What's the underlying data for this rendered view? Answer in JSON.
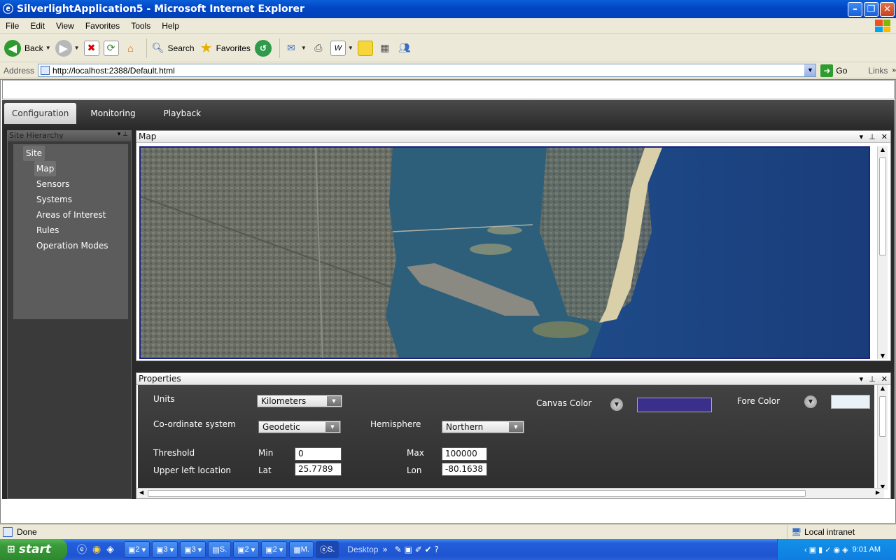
{
  "window": {
    "title": "SilverlightApplication5 - Microsoft Internet Explorer"
  },
  "menu": [
    "File",
    "Edit",
    "View",
    "Favorites",
    "Tools",
    "Help"
  ],
  "toolbar": {
    "back": "Back",
    "search": "Search",
    "favorites": "Favorites"
  },
  "address": {
    "label": "Address",
    "url": "http://localhost:2388/Default.html",
    "go": "Go",
    "links": "Links"
  },
  "app": {
    "tabs": [
      "Configuration",
      "Monitoring",
      "Playback"
    ],
    "left_panel": {
      "title": "Site Hierarchy",
      "root": "Site",
      "children": [
        "Map",
        "Sensors",
        "Systems",
        "Areas of Interest",
        "Rules",
        "Operation Modes"
      ]
    },
    "map_panel": {
      "title": "Map"
    },
    "properties": {
      "title": "Properties",
      "units_label": "Units",
      "units_value": "Kilometers",
      "coord_label": "Co-ordinate system",
      "coord_value": "Geodetic",
      "hemisphere_label": "Hemisphere",
      "hemisphere_value": "Northern",
      "canvas_color_label": "Canvas Color",
      "fore_color_label": "Fore Color",
      "threshold_label": "Threshold",
      "min_label": "Min",
      "min_value": "0",
      "max_label": "Max",
      "max_value": "100000",
      "upper_left_label": "Upper left location",
      "lat_label": "Lat",
      "lat_value": "25.7789",
      "lon_label": "Lon",
      "lon_value": "-80.1638"
    }
  },
  "colors": {
    "canvas_color": "#3a2f8a",
    "fore_color": "#e8f2f8"
  },
  "status": {
    "text": "Done",
    "zone": "Local intranet"
  },
  "taskbar": {
    "start": "start",
    "items": [
      "2",
      "3",
      "3",
      "S.",
      "2",
      "2",
      "M.",
      "S."
    ],
    "desktop": "Desktop",
    "clock": "9:01 AM"
  }
}
